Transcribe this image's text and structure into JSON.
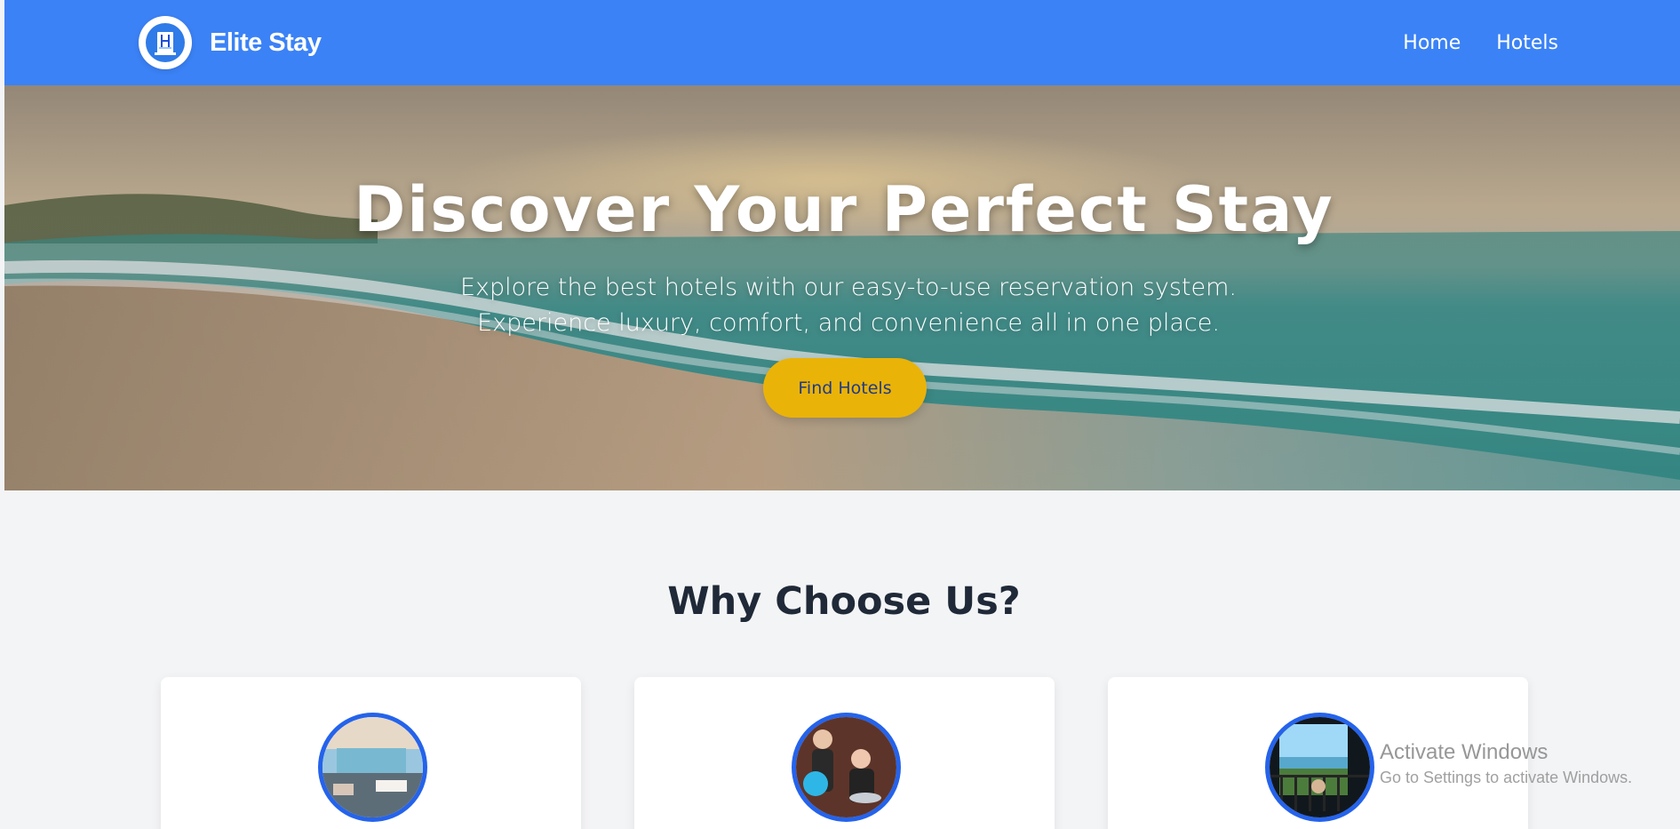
{
  "header": {
    "brand_name": "Elite Stay",
    "logo_icon": "hotel-logo-icon",
    "nav": [
      {
        "label": "Home"
      },
      {
        "label": "Hotels"
      }
    ]
  },
  "hero": {
    "title": "Discover Your Perfect Stay",
    "subtitle": "Explore the best hotels with our easy-to-use reservation system. Experience luxury, comfort, and convenience all in one place.",
    "cta_label": "Find Hotels"
  },
  "features": {
    "title": "Why Choose Us?",
    "cards": [
      {
        "icon": "hotel-room-image"
      },
      {
        "icon": "hotel-staff-image"
      },
      {
        "icon": "balcony-view-image"
      }
    ]
  },
  "watermark": {
    "title": "Activate Windows",
    "subtitle": "Go to Settings to activate Windows."
  },
  "colors": {
    "primary": "#3b82f6",
    "accent": "#eab308",
    "dark_text": "#1f2937",
    "card_border": "#2563eb"
  }
}
